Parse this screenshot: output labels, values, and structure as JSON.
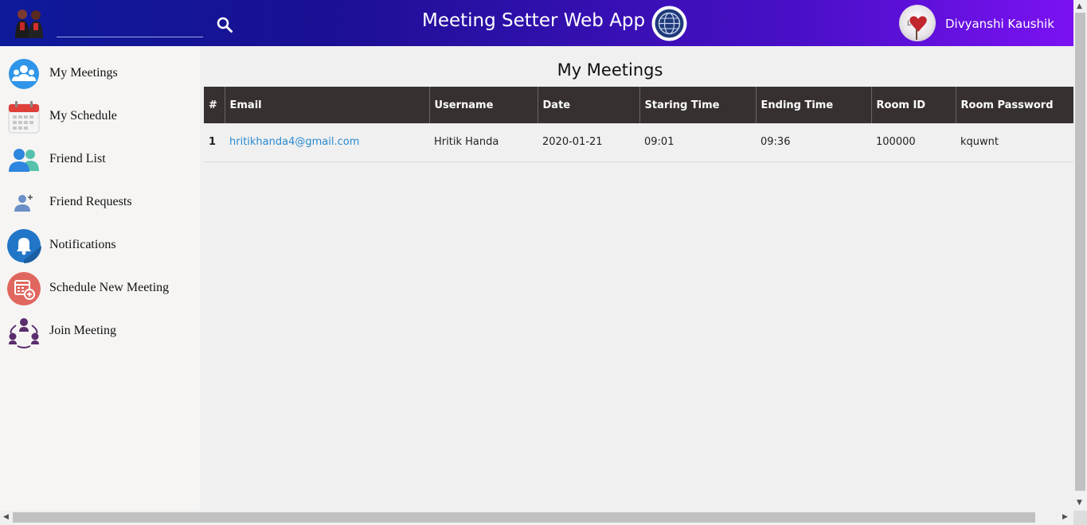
{
  "header": {
    "app_title": "Meeting Setter Web App",
    "search_placeholder": "",
    "user_name": "Divyanshi Kaushik",
    "colors": {
      "gradient_start": "#0d1a9a",
      "gradient_end": "#7b12f2"
    }
  },
  "sidebar": {
    "items": [
      {
        "label": "My Meetings",
        "icon": "people-group-icon"
      },
      {
        "label": "My Schedule",
        "icon": "calendar-icon"
      },
      {
        "label": "Friend List",
        "icon": "friends-icon"
      },
      {
        "label": "Friend Requests",
        "icon": "add-user-icon"
      },
      {
        "label": "Notifications",
        "icon": "bell-icon"
      },
      {
        "label": "Schedule New Meeting",
        "icon": "calendar-add-icon"
      },
      {
        "label": "Join Meeting",
        "icon": "join-meeting-icon"
      }
    ]
  },
  "main": {
    "title": "My Meetings",
    "table": {
      "headers": [
        "#",
        "Email",
        "Username",
        "Date",
        "Staring Time",
        "Ending Time",
        "Room ID",
        "Room Password"
      ],
      "rows": [
        {
          "index": "1",
          "email": "hritikhanda4@gmail.com",
          "username": "Hritik Handa",
          "date": "2020-01-21",
          "start": "09:01",
          "end": "09:36",
          "room_id": "100000",
          "room_password": "kquwnt"
        }
      ]
    }
  }
}
